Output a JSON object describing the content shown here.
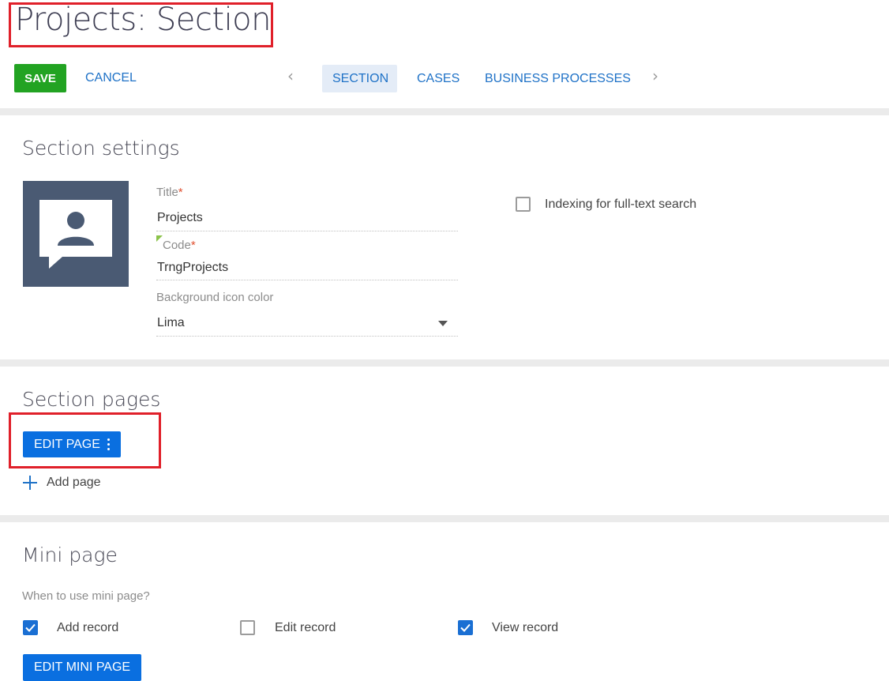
{
  "header": {
    "title": "Projects: Section"
  },
  "toolbar": {
    "save_label": "SAVE",
    "cancel_label": "CANCEL",
    "tabs": [
      {
        "label": "SECTION",
        "active": true
      },
      {
        "label": "CASES",
        "active": false
      },
      {
        "label": "BUSINESS PROCESSES",
        "active": false
      }
    ]
  },
  "section_settings": {
    "heading": "Section settings",
    "icon": "person-chat-icon",
    "title_label": "Title",
    "title_value": "Projects",
    "code_label": "Code",
    "code_value": "TrngProjects",
    "required_mark": "*",
    "bg_color_label": "Background icon color",
    "bg_color_value": "Lima",
    "indexing_label": "Indexing for full-text search",
    "indexing_checked": false
  },
  "section_pages": {
    "heading": "Section pages",
    "edit_page_label": "EDIT PAGE",
    "add_page_label": "Add page"
  },
  "mini_page": {
    "heading": "Mini page",
    "hint": "When to use mini page?",
    "options": [
      {
        "label": "Add record",
        "checked": true
      },
      {
        "label": "Edit record",
        "checked": false
      },
      {
        "label": "View record",
        "checked": true
      }
    ],
    "edit_mini_page_label": "EDIT MINI PAGE"
  },
  "colors": {
    "save_green": "#22a322",
    "accent_blue": "#0a6fe0",
    "link_blue": "#1f72c7",
    "highlight_red": "#e0202a",
    "icon_tile": "#4a5a73"
  }
}
